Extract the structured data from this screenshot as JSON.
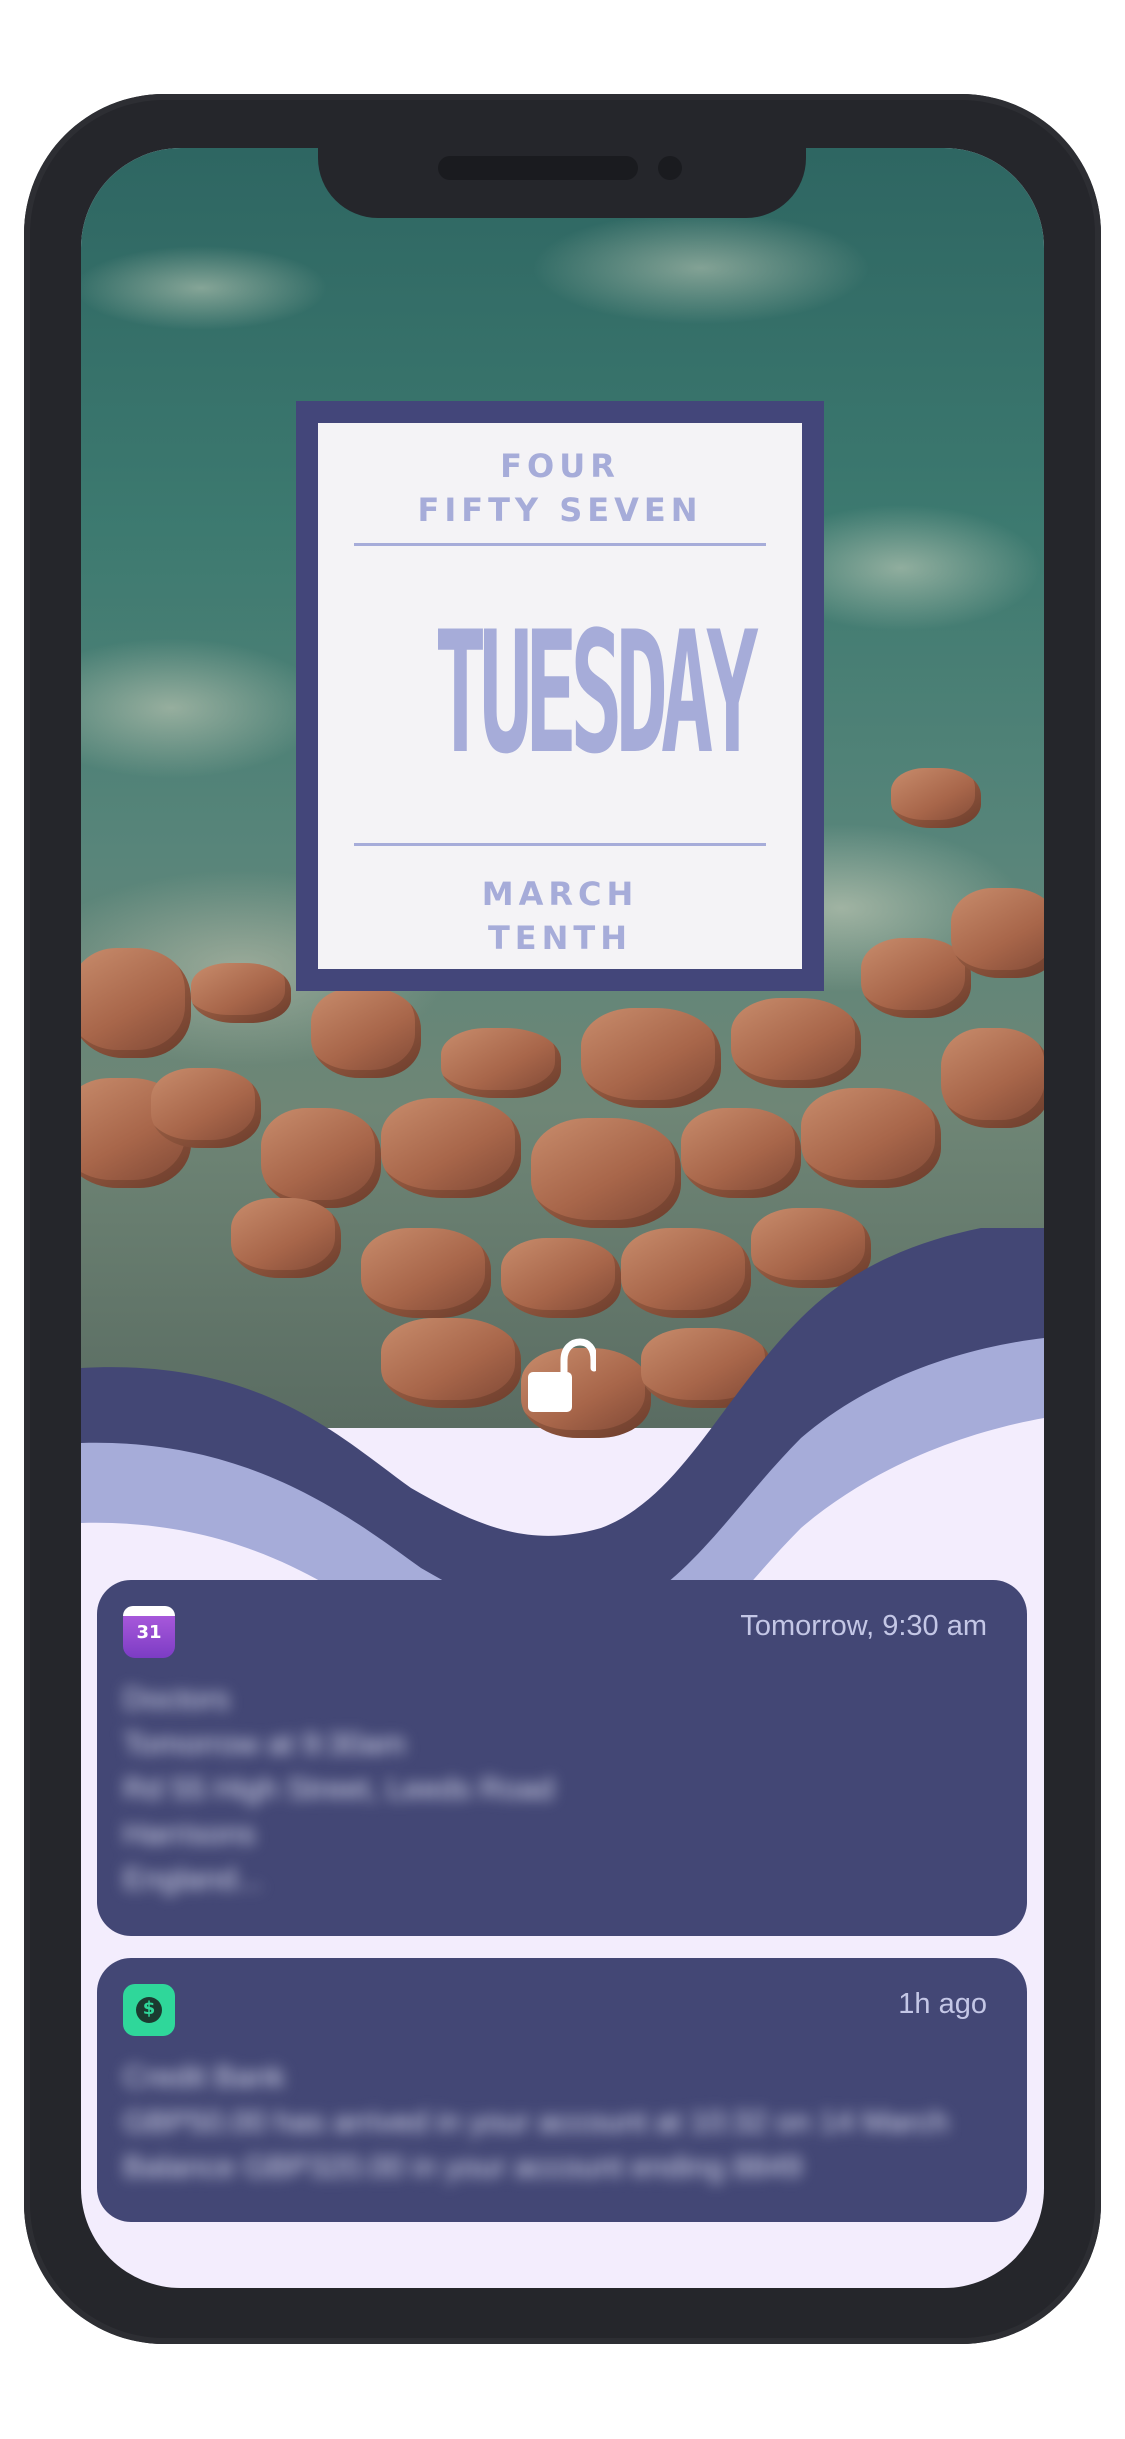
{
  "lock_screen": {
    "time_line_1": "FOUR",
    "time_line_2": "FIFTY SEVEN",
    "day": "TUESDAY",
    "date_line_1": "MARCH",
    "date_line_2": "TENTH",
    "unlock_icon": "unlock-icon"
  },
  "notifications": [
    {
      "app_icon": "calendar-icon",
      "app_icon_text": "31",
      "time": "Tomorrow, 9:30 am",
      "lines": [
        "Doctors",
        "Tomorrow at 9:30am",
        "Rd 55 High Street, Leeds Road",
        "Harrisons",
        "England..."
      ]
    },
    {
      "app_icon": "cash-app-icon",
      "app_icon_text": "$",
      "time": "1h ago",
      "lines": [
        "Credit Bank",
        "GBP50.00 has arrived in your account at 10:32 on 14 March",
        "Balance GBP320.00 in your account ending 8849"
      ]
    }
  ],
  "colors": {
    "frame": "#25262b",
    "navy": "#434775",
    "periwinkle": "#a6acd9",
    "lavender_bg": "#f3edfd",
    "card_bg": "#f4f3f6"
  }
}
